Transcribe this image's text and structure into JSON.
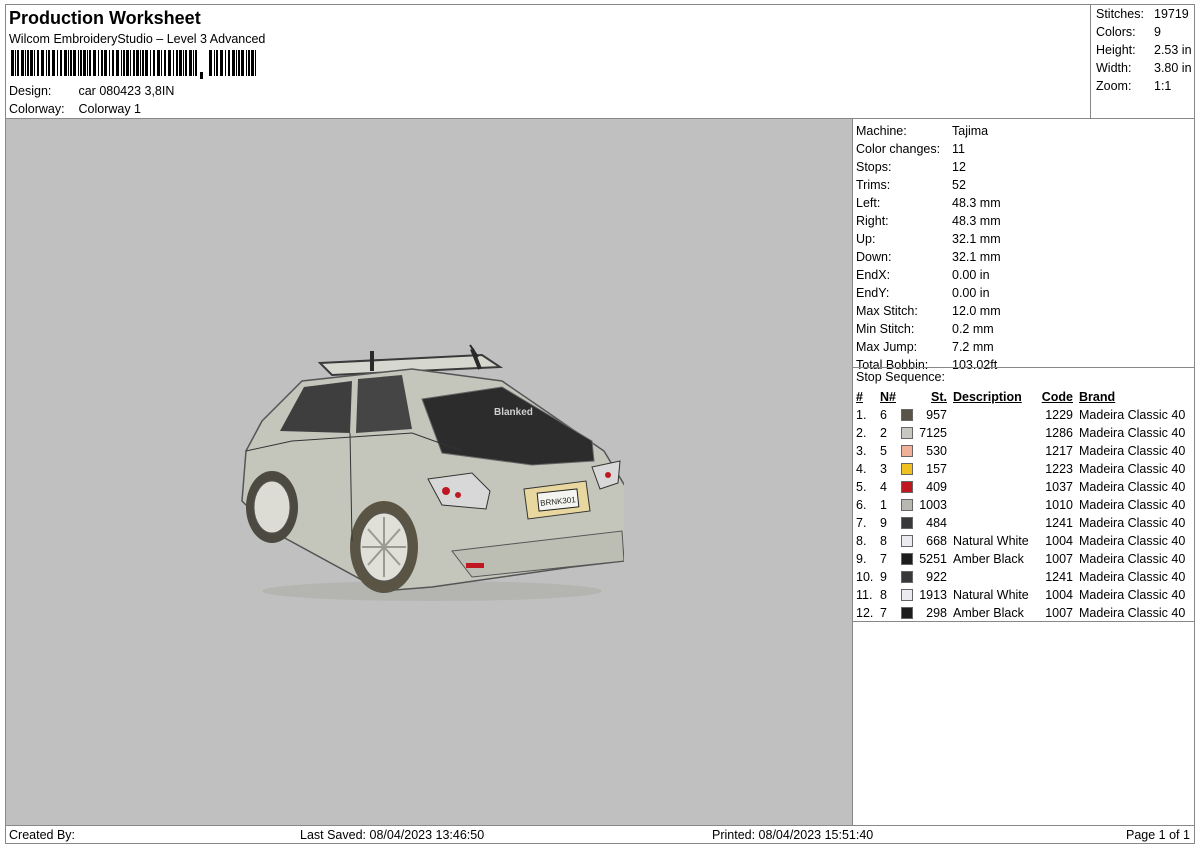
{
  "header": {
    "title": "Production Worksheet",
    "subtitle": "Wilcom EmbroideryStudio – Level 3 Advanced",
    "design_label": "Design:",
    "design_value": "car 080423 3,8IN",
    "colorway_label": "Colorway:",
    "colorway_value": "Colorway 1"
  },
  "summary": {
    "stitches_label": "Stitches:",
    "stitches": "19719",
    "colors_label": "Colors:",
    "colors": "9",
    "height_label": "Height:",
    "height": "2.53 in",
    "width_label": "Width:",
    "width": "3.80 in",
    "zoom_label": "Zoom:",
    "zoom": "1:1"
  },
  "machine": [
    {
      "label": "Machine:",
      "value": "Tajima"
    },
    {
      "label": "Color changes:",
      "value": "11"
    },
    {
      "label": "Stops:",
      "value": "12"
    },
    {
      "label": "Trims:",
      "value": "52"
    },
    {
      "label": "Left:",
      "value": "48.3 mm"
    },
    {
      "label": "Right:",
      "value": "48.3 mm"
    },
    {
      "label": "Up:",
      "value": "32.1 mm"
    },
    {
      "label": "Down:",
      "value": "32.1 mm"
    },
    {
      "label": "EndX:",
      "value": "0.00 in"
    },
    {
      "label": "EndY:",
      "value": "0.00 in"
    },
    {
      "label": "Max Stitch:",
      "value": "12.0 mm"
    },
    {
      "label": "Min Stitch:",
      "value": "0.2 mm"
    },
    {
      "label": "Max Jump:",
      "value": "7.2 mm"
    },
    {
      "label": "Total Bobbin:",
      "value": "103.02ft"
    }
  ],
  "stop_sequence": {
    "title": "Stop Sequence:",
    "headers": {
      "idx": "#",
      "n": "N#",
      "st": "St.",
      "desc": "Description",
      "code": "Code",
      "brand": "Brand"
    },
    "rows": [
      {
        "idx": "1.",
        "n": "6",
        "color": "#5a5448",
        "st": "957",
        "desc": "",
        "code": "1229",
        "brand": "Madeira Classic 40"
      },
      {
        "idx": "2.",
        "n": "2",
        "color": "#c8c8c0",
        "st": "7125",
        "desc": "",
        "code": "1286",
        "brand": "Madeira Classic 40"
      },
      {
        "idx": "3.",
        "n": "5",
        "color": "#f0b09a",
        "st": "530",
        "desc": "",
        "code": "1217",
        "brand": "Madeira Classic 40"
      },
      {
        "idx": "4.",
        "n": "3",
        "color": "#f0c020",
        "st": "157",
        "desc": "",
        "code": "1223",
        "brand": "Madeira Classic 40"
      },
      {
        "idx": "5.",
        "n": "4",
        "color": "#c01820",
        "st": "409",
        "desc": "",
        "code": "1037",
        "brand": "Madeira Classic 40"
      },
      {
        "idx": "6.",
        "n": "1",
        "color": "#b8b8b0",
        "st": "1003",
        "desc": "",
        "code": "1010",
        "brand": "Madeira Classic 40"
      },
      {
        "idx": "7.",
        "n": "9",
        "color": "#38383a",
        "st": "484",
        "desc": "",
        "code": "1241",
        "brand": "Madeira Classic 40"
      },
      {
        "idx": "8.",
        "n": "8",
        "color": "#eaeaf0",
        "st": "668",
        "desc": "Natural White",
        "code": "1004",
        "brand": "Madeira Classic 40"
      },
      {
        "idx": "9.",
        "n": "7",
        "color": "#1c1c1c",
        "st": "5251",
        "desc": "Amber Black",
        "code": "1007",
        "brand": "Madeira Classic 40"
      },
      {
        "idx": "10.",
        "n": "9",
        "color": "#38383a",
        "st": "922",
        "desc": "",
        "code": "1241",
        "brand": "Madeira Classic 40"
      },
      {
        "idx": "11.",
        "n": "8",
        "color": "#eaeaf0",
        "st": "1913",
        "desc": "Natural White",
        "code": "1004",
        "brand": "Madeira Classic 40"
      },
      {
        "idx": "12.",
        "n": "7",
        "color": "#1c1c1c",
        "st": "298",
        "desc": "Amber Black",
        "code": "1007",
        "brand": "Madeira Classic 40"
      }
    ]
  },
  "preview": {
    "plate_text": "BRNK301",
    "window_text": "Blanked"
  },
  "footer": {
    "created_by": "Created By:",
    "last_saved": "Last Saved: 08/04/2023 13:46:50",
    "printed": "Printed: 08/04/2023 15:51:40",
    "page": "Page 1 of 1"
  }
}
